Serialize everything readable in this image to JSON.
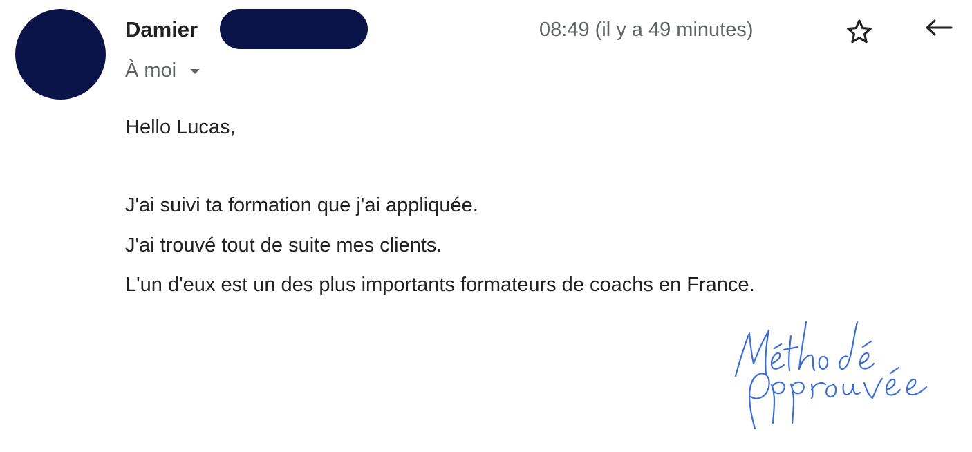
{
  "header": {
    "sender_name": "Damier",
    "recipient_label": "À moi",
    "timestamp": "08:49 (il y a 49 minutes)",
    "star_icon": "star-outline-icon",
    "reply_icon": "reply-arrow-icon"
  },
  "body": {
    "greeting": "Hello Lucas,",
    "lines": [
      "J'ai suivi ta formation que j'ai appliquée.",
      "J'ai trouvé tout de suite mes clients.",
      "L'un d'eux est un des plus importants formateurs de coachs en France."
    ]
  },
  "stamp": {
    "text_line_1": "Méthode",
    "text_line_2": "Approuvée",
    "color": "#3b6ed6"
  },
  "colors": {
    "redaction": "#0a1448",
    "avatar": "#0a1448",
    "text": "#202124",
    "secondary_text": "#5f6368"
  }
}
